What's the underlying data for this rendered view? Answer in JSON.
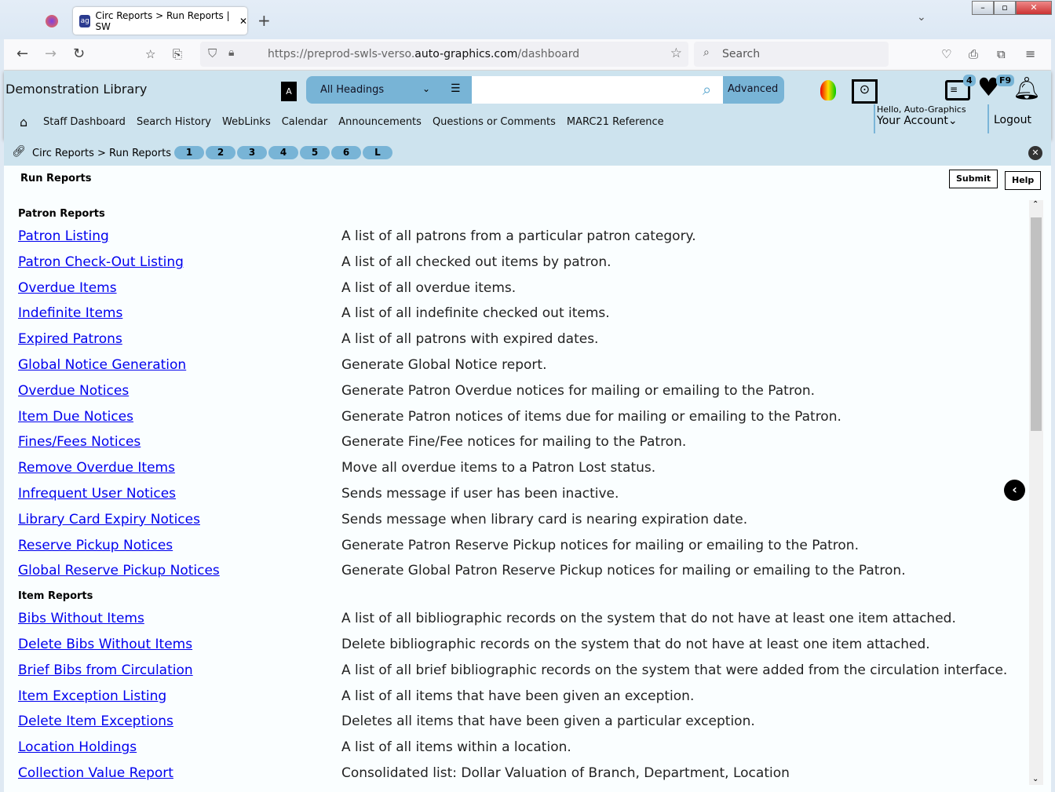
{
  "browser": {
    "tab_title": "Circ Reports > Run Reports | SW",
    "url_prefix": "https://preprod-swls-verso.",
    "url_domain": "auto-graphics.com",
    "url_suffix": "/dashboard",
    "search_placeholder": "Search"
  },
  "header": {
    "library": "Demonstration Library",
    "search_scope": "All Headings",
    "advanced": "Advanced",
    "list_badge": "4",
    "fav_badge": "F9",
    "hello": "Hello, Auto-Graphics",
    "account": "Your Account",
    "logout": "Logout",
    "menu": [
      "Staff Dashboard",
      "Search History",
      "WebLinks",
      "Calendar",
      "Announcements",
      "Questions or Comments",
      "MARC21 Reference"
    ]
  },
  "breadcrumb": {
    "text": "Circ Reports > Run Reports",
    "pills": [
      "1",
      "2",
      "3",
      "4",
      "5",
      "6",
      "L"
    ]
  },
  "page": {
    "title": "Run Reports",
    "submit": "Submit",
    "help": "Help"
  },
  "sections": [
    {
      "title": "Patron Reports",
      "items": [
        [
          "Patron Listing",
          "A list of all patrons from a particular patron category."
        ],
        [
          "Patron Check-Out Listing",
          "A list of all checked out items by patron."
        ],
        [
          "Overdue Items",
          "A list of all overdue items."
        ],
        [
          "Indefinite Items",
          "A list of all indefinite checked out items."
        ],
        [
          "Expired Patrons",
          "A list of all patrons with expired dates."
        ],
        [
          "Global Notice Generation",
          "Generate Global Notice report."
        ],
        [
          "Overdue Notices",
          "Generate Patron Overdue notices for mailing or emailing to the Patron."
        ],
        [
          "Item Due Notices",
          "Generate Patron notices of items due for mailing or emailing to the Patron."
        ],
        [
          "Fines/Fees Notices",
          "Generate Fine/Fee notices for mailing to the Patron."
        ],
        [
          "Remove Overdue Items",
          "Move all overdue items to a Patron Lost status."
        ],
        [
          "Infrequent User Notices",
          "Sends message if user has been inactive."
        ],
        [
          "Library Card Expiry Notices",
          "Sends message when library card is nearing expiration date."
        ],
        [
          "Reserve Pickup Notices",
          "Generate Patron Reserve Pickup notices for mailing or emailing to the Patron."
        ],
        [
          "Global Reserve Pickup Notices",
          "Generate Global Patron Reserve Pickup notices for mailing or emailing to the Patron."
        ]
      ]
    },
    {
      "title": "Item Reports",
      "items": [
        [
          "Bibs Without Items",
          "A list of all bibliographic records on the system that do not have at least one item attached."
        ],
        [
          "Delete Bibs Without Items",
          "Delete bibliographic records on the system that do not have at least one item attached."
        ],
        [
          "Brief Bibs from Circulation",
          "A list of all brief bibliographic records on the system that were added from the circulation interface."
        ],
        [
          "Item Exception Listing",
          "A list of all items that have been given an exception."
        ],
        [
          "Delete Item Exceptions",
          "Deletes all items that have been given a particular exception."
        ],
        [
          "Location Holdings",
          "A list of all items within a location."
        ],
        [
          "Collection Value Report",
          "Consolidated list: Dollar Valuation of Branch, Department, Location"
        ]
      ]
    }
  ]
}
